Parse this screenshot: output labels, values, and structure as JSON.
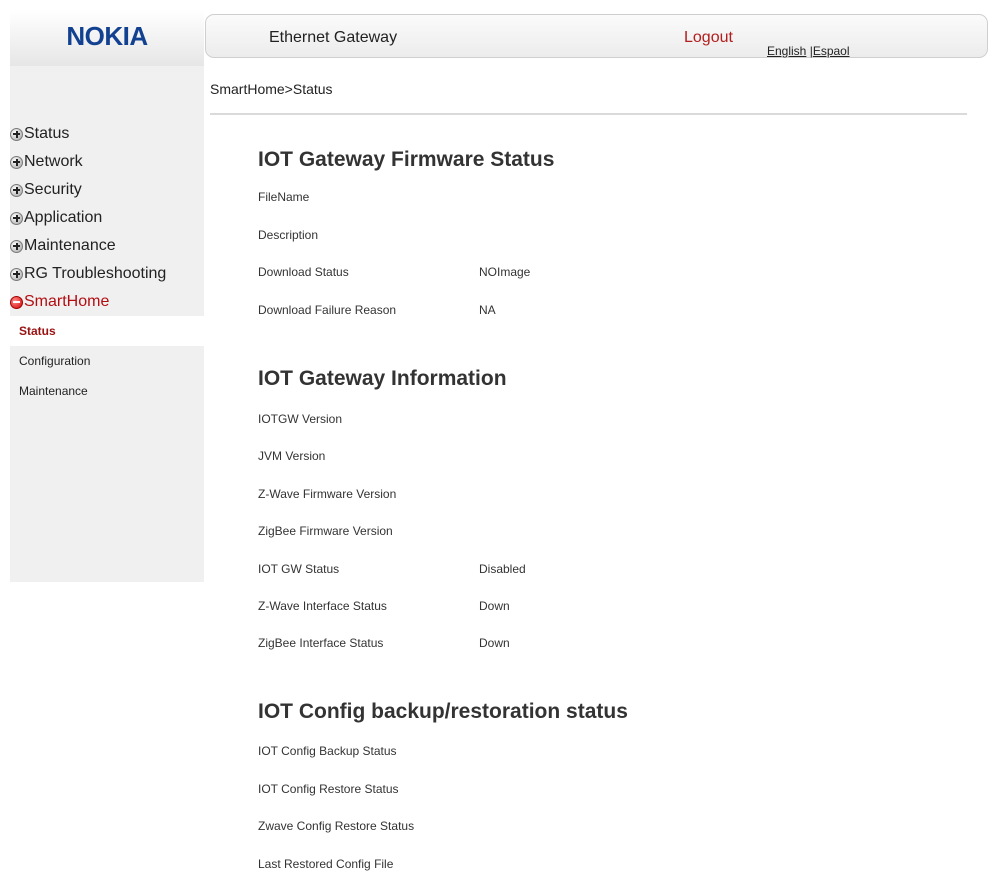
{
  "brand": {
    "logo": "NOKIA"
  },
  "header": {
    "title": "Ethernet Gateway",
    "logout": "Logout",
    "lang_english": "English",
    "lang_sep": " |",
    "lang_spanish": "Espaol"
  },
  "breadcrumb": "SmartHome>Status",
  "sidebar": {
    "items": [
      {
        "label": "Status",
        "icon": "plus-circle-icon"
      },
      {
        "label": "Network",
        "icon": "plus-circle-icon"
      },
      {
        "label": "Security",
        "icon": "plus-circle-icon"
      },
      {
        "label": "Application",
        "icon": "plus-circle-icon"
      },
      {
        "label": "Maintenance",
        "icon": "plus-circle-icon"
      },
      {
        "label": "RG Troubleshooting",
        "icon": "plus-circle-icon"
      },
      {
        "label": "SmartHome",
        "icon": "minus-circle-icon",
        "expanded": true
      }
    ],
    "subitems": [
      {
        "label": "Status",
        "selected": true
      },
      {
        "label": "Configuration"
      },
      {
        "label": "Maintenance"
      }
    ]
  },
  "sections": [
    {
      "title": "IOT Gateway Firmware Status",
      "rows": [
        {
          "label": "FileName",
          "value": ""
        },
        {
          "label": "Description",
          "value": ""
        },
        {
          "label": "Download Status",
          "value": "NOImage"
        },
        {
          "label": "Download Failure Reason",
          "value": "NA"
        }
      ]
    },
    {
      "title": "IOT Gateway Information",
      "rows": [
        {
          "label": "IOTGW Version",
          "value": ""
        },
        {
          "label": "JVM Version",
          "value": ""
        },
        {
          "label": "Z-Wave Firmware Version",
          "value": ""
        },
        {
          "label": "ZigBee Firmware Version",
          "value": ""
        },
        {
          "label": "IOT GW Status",
          "value": "Disabled"
        },
        {
          "label": "Z-Wave Interface Status",
          "value": "Down"
        },
        {
          "label": "ZigBee Interface Status",
          "value": "Down"
        }
      ]
    },
    {
      "title": "IOT Config backup/restoration status",
      "rows": [
        {
          "label": "IOT Config Backup Status",
          "value": ""
        },
        {
          "label": "IOT Config Restore Status",
          "value": ""
        },
        {
          "label": "Zwave Config Restore Status",
          "value": ""
        },
        {
          "label": "Last Restored Config File",
          "value": ""
        }
      ]
    }
  ],
  "colors": {
    "brand_blue": "#124191",
    "accent_red": "#b20e12",
    "sidebar_bg": "#f0f0f0"
  }
}
